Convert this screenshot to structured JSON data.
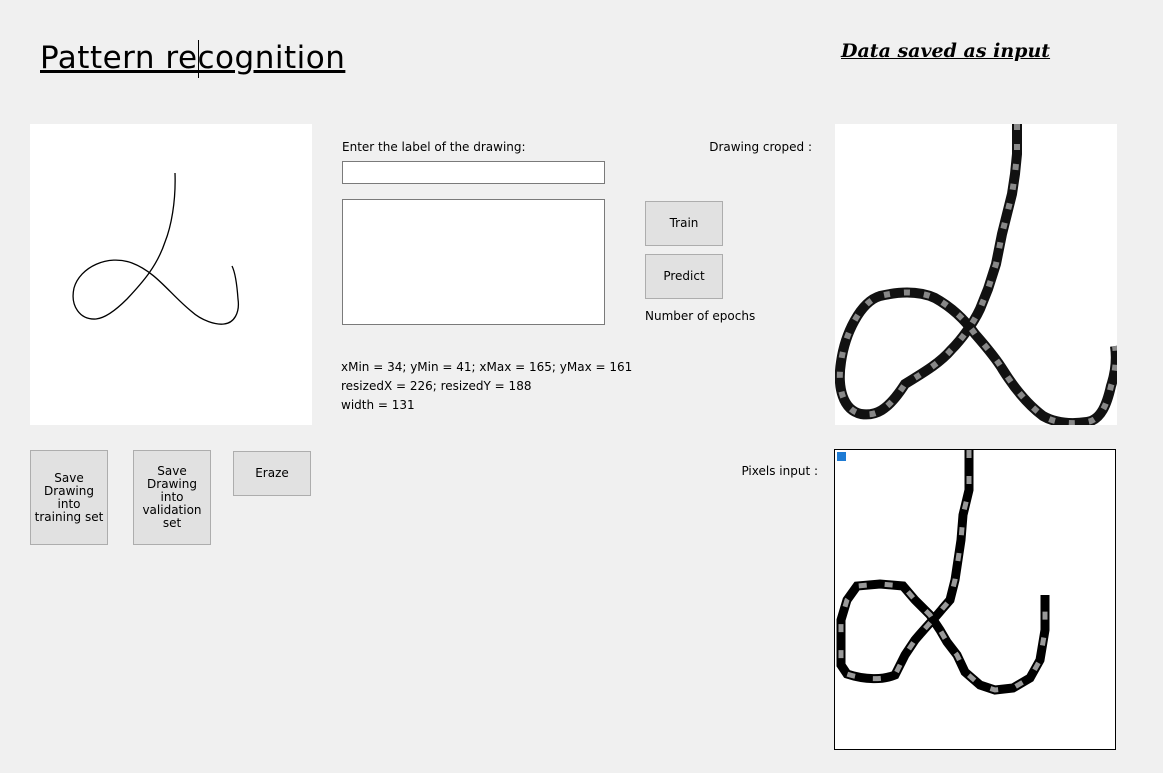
{
  "header": {
    "title": "Pattern recognition",
    "saved_title": "Data saved as input"
  },
  "form": {
    "label_prompt": "Enter the label of the drawing:",
    "label_value": "",
    "notes_value": ""
  },
  "buttons": {
    "train": "Train",
    "predict": "Predict",
    "save_training": "Save Drawing into training set",
    "save_validation": "Save Drawing into validation set",
    "erase": "Eraze"
  },
  "labels": {
    "epochs": "Number of epochs",
    "drawing_cropped": "Drawing croped :",
    "pixels_input": "Pixels input :"
  },
  "stats": {
    "bounds": "xMin = 34; yMin = 41; xMax = 165; yMax = 161",
    "resized": "resizedX = 226; resizedY = 188",
    "width": "width = 131"
  },
  "colors": {
    "window_bg": "#f0f0f0",
    "button_bg": "#e1e1e1",
    "selected_pixel": "#1e7bd4"
  }
}
